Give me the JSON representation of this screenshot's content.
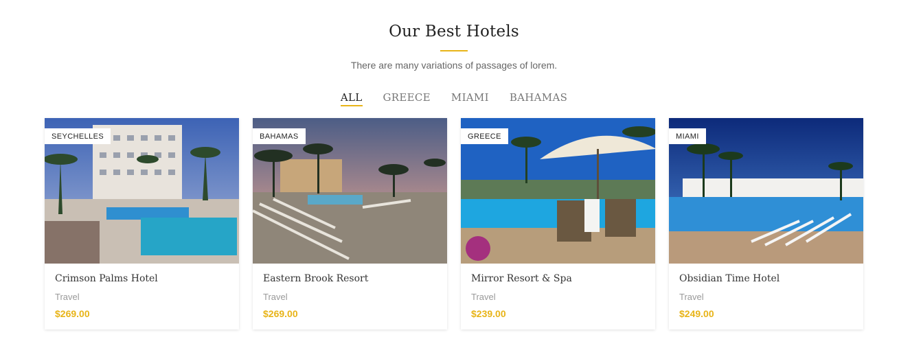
{
  "section": {
    "title": "Our Best Hotels",
    "subtitle": "There are many variations of passages of lorem."
  },
  "filters": [
    {
      "label": "ALL",
      "active": true
    },
    {
      "label": "GREECE",
      "active": false
    },
    {
      "label": "MIAMI",
      "active": false
    },
    {
      "label": "BAHAMAS",
      "active": false
    }
  ],
  "hotels": [
    {
      "badge": "SEYCHELLES",
      "name": "Crimson Palms Hotel",
      "category": "Travel",
      "price": "$269.00"
    },
    {
      "badge": "BAHAMAS",
      "name": "Eastern Brook Resort",
      "category": "Travel",
      "price": "$269.00"
    },
    {
      "badge": "GREECE",
      "name": "Mirror Resort & Spa",
      "category": "Travel",
      "price": "$239.00"
    },
    {
      "badge": "MIAMI",
      "name": "Obsidian Time Hotel",
      "category": "Travel",
      "price": "$249.00"
    }
  ],
  "colors": {
    "accent": "#e8b418"
  }
}
